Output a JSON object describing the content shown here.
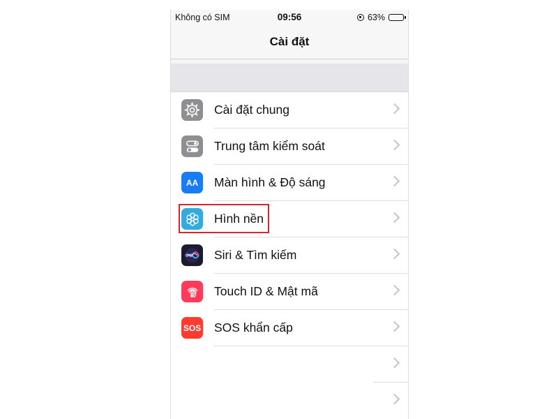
{
  "status_bar": {
    "carrier": "Không có SIM",
    "time": "09:56",
    "battery_percent": "63%",
    "battery_level": 0.63
  },
  "nav": {
    "title": "Cài đặt"
  },
  "settings": {
    "items": [
      {
        "label": "Cài đặt chung",
        "icon": "gear-icon"
      },
      {
        "label": "Trung tâm kiểm soát",
        "icon": "control-center-icon"
      },
      {
        "label": "Màn hình & Độ sáng",
        "icon": "display-brightness-icon",
        "icon_text": "AA"
      },
      {
        "label": "Hình nền",
        "icon": "wallpaper-icon",
        "highlighted": true
      },
      {
        "label": "Siri & Tìm kiếm",
        "icon": "siri-icon"
      },
      {
        "label": "Touch ID & Mật mã",
        "icon": "fingerprint-icon"
      },
      {
        "label": "SOS khẩn cấp",
        "icon": "sos-icon",
        "icon_text": "SOS"
      }
    ]
  },
  "colors": {
    "highlight_border": "#d4262c",
    "display_icon": "#1a7cf5",
    "wallpaper_icon": "#35aadc",
    "touchid_icon": "#ff3b5c",
    "sos_icon": "#ff3b30"
  }
}
